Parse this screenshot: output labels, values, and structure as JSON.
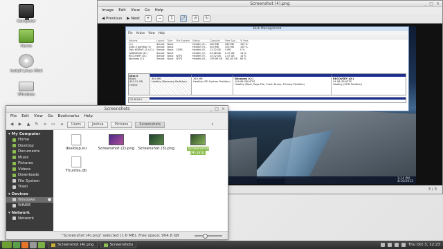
{
  "desktop": {
    "icons": [
      {
        "label": "Computer",
        "icon": "computer-icon"
      },
      {
        "label": "Home",
        "icon": "home-folder-icon"
      },
      {
        "label": "Install Linux Mint",
        "icon": "install-disc-icon"
      },
      {
        "label": "Windows",
        "icon": "drive-icon"
      }
    ]
  },
  "viewer": {
    "title": "Screenshot (4).png",
    "menu": [
      "Image",
      "Edit",
      "View",
      "Go",
      "Help"
    ],
    "toolbar": {
      "previous": "Previous",
      "next": "Next"
    },
    "page_counter": "3 / 3"
  },
  "inner_shot": {
    "disk_mgmt_title": "Disk Management",
    "menu": [
      "File",
      "Action",
      "View",
      "Help"
    ],
    "columns": [
      "Volume",
      "Layout",
      "Type",
      "File System",
      "Status",
      "Capacity",
      "Free Spa...",
      "% Free"
    ],
    "rows": [
      [
        "(C:)",
        "Simple",
        "Basic",
        "",
        "Healthy (E...",
        "260 MB",
        "260 MB",
        "100 %"
      ],
      [
        "(Disk 0 partition 5)",
        "Simple",
        "Basic",
        "",
        "Healthy (R...",
        "300 MB",
        "300 MB",
        "100 %"
      ],
      [
        "Disk #DRIVE (Z:) (C:)",
        "Simple",
        "Basic",
        "CDFS",
        "Healthy (P...",
        "13.52 GB",
        "0 MB",
        "0 %"
      ],
      [
        "HARDDOSK (D:)",
        "Simple",
        "Basic",
        "",
        "Healthy (P...",
        "24.58 GB",
        "2.47 GB",
        "14 %"
      ],
      [
        "RECOVERY (D:)",
        "Simple",
        "Basic",
        "NTFS",
        "Healthy (P...",
        "24.52 GB",
        "2.47 GB",
        "14 %"
      ],
      [
        "Windows (C:)",
        "Simple",
        "Basic",
        "NTFS",
        "Healthy (B...",
        "199.98 GB",
        "161.85 GB",
        "85 %"
      ]
    ],
    "disk0_label": [
      "Disk 0",
      "Basic",
      "931.51 GB",
      "Online"
    ],
    "partitions": [
      {
        "name": "",
        "size": "300 MB",
        "status": "Healthy (Recovery Partition)"
      },
      {
        "name": "",
        "size": "260 MB",
        "status": "Healthy (EFI System Partition)"
      },
      {
        "name": "Windows (C:)",
        "size": "199.98 GB NTFS",
        "status": "Healthy (Boot, Page File, Crash Dump, Primary Partition)"
      },
      {
        "name": "RECOVERY (D:)",
        "size": "24.58 GB NTFS",
        "status": "Healthy (OEM Partition)"
      }
    ],
    "cd_label": "CD-ROM 0",
    "legend": [
      "Unallocated",
      "Primary partition"
    ],
    "taskbar_item": "Disk Managem...",
    "clock": "3:14 PM\n4/10/2013"
  },
  "file_manager": {
    "title": "Screenshots",
    "menu": [
      "File",
      "Edit",
      "View",
      "Go",
      "Bookmarks",
      "Help"
    ],
    "breadcrumbs": [
      "Users",
      "Joshua",
      "Pictures",
      "Screenshots"
    ],
    "sidebar": {
      "sections": [
        {
          "header": "My Computer",
          "items": [
            "Home",
            "Desktop",
            "Documents",
            "Music",
            "Pictures",
            "Videos",
            "Downloads",
            "File System",
            "Trash"
          ]
        },
        {
          "header": "Devices",
          "items": [
            "Windows",
            "WINRE"
          ]
        },
        {
          "header": "Network",
          "items": [
            "Network"
          ]
        }
      ]
    },
    "files": [
      {
        "name": "desktop.ini",
        "kind": "doc"
      },
      {
        "name": "Screenshot (2).png",
        "kind": "pic"
      },
      {
        "name": "Screenshot (3).png",
        "kind": "pic"
      },
      {
        "name": "Screenshot (4).png",
        "kind": "pic",
        "selected": true
      },
      {
        "name": "Thumbs.db",
        "kind": "doc"
      }
    ],
    "status": "\"Screenshot (4).png\" selected (1.6 MB), Free space: 904.8 GB"
  },
  "panel": {
    "menu_label": "Menu",
    "tasks": [
      "Screenshot (4).png",
      "Screenshots"
    ],
    "clock": "Thu Oct 3, 12:23"
  },
  "colors": {
    "accent": "#8cbd4f",
    "sidebar_bg": "#3b3b3b",
    "panel_bg": "#2c2c2c"
  }
}
